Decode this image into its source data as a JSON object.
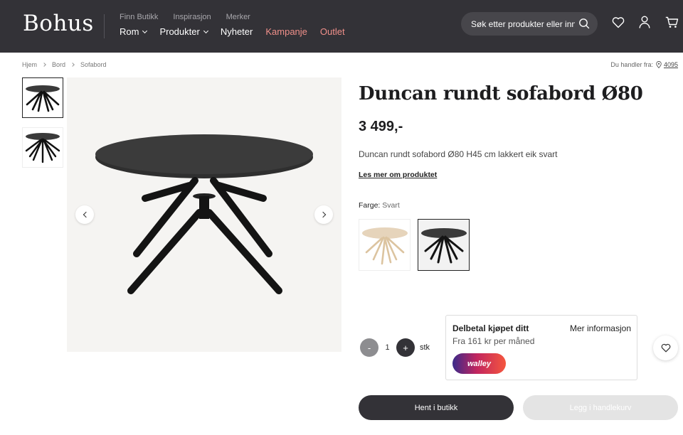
{
  "header": {
    "logo": "Bohus",
    "subnav": [
      "Finn Butikk",
      "Inspirasjon",
      "Merker"
    ],
    "nav": [
      {
        "label": "Rom",
        "dropdown": true
      },
      {
        "label": "Produkter",
        "dropdown": true
      },
      {
        "label": "Nyheter",
        "dropdown": false
      },
      {
        "label": "Kampanje",
        "dropdown": false
      },
      {
        "label": "Outlet",
        "dropdown": false
      }
    ],
    "search_placeholder": "Søk etter produkter eller innhold",
    "icons": [
      "search-icon",
      "heart-icon",
      "user-icon",
      "cart-icon"
    ]
  },
  "breadcrumb": [
    "Hjem",
    "Bord",
    "Sofabord"
  ],
  "location": {
    "label": "Du handler fra:",
    "zip": "4095"
  },
  "product": {
    "title": "Duncan rundt sofabord Ø80",
    "price": "3 499,-",
    "description": "Duncan rundt sofabord Ø80 H45 cm lakkert eik svart",
    "read_more": "Les mer om produktet",
    "color_label": "Farge:",
    "color_value": "Svart",
    "swatches": [
      {
        "name": "Natur eik",
        "color": "#e6d4bb",
        "selected": false
      },
      {
        "name": "Svart",
        "color": "#1f1f1f",
        "selected": true
      }
    ]
  },
  "quantity": {
    "minus": "-",
    "value": "1",
    "plus": "+",
    "unit": "stk"
  },
  "financing": {
    "title": "Delbetal kjøpet ditt",
    "more": "Mer informasjon",
    "subtitle": "Fra 161 kr per måned",
    "provider": "walley"
  },
  "actions": {
    "pickup": "Hent i butikk",
    "add_to_cart": "Legg i handlekurv"
  },
  "colors": {
    "header_bg": "#333237",
    "accent": "#f0908a",
    "dark_button": "#333237",
    "disabled_button": "#e4e4e4"
  }
}
